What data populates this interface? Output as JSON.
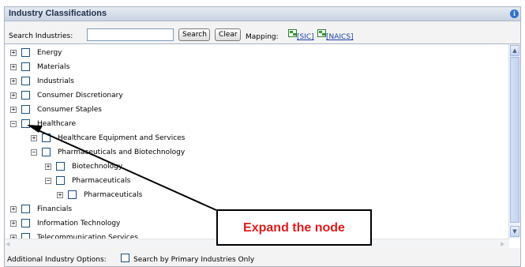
{
  "header": {
    "title": "Industry Classifications",
    "info_icon": "info-icon"
  },
  "search": {
    "label": "Search Industries:",
    "value": "",
    "placeholder": "",
    "search_button": "Search",
    "clear_button": "Clear",
    "mapping_label": "Mapping:",
    "sic_link": "[SIC]",
    "naics_link": "[NAICS]",
    "icons": [
      "excel-icon",
      "excel-icon"
    ]
  },
  "tree": {
    "nodes": [
      {
        "label": "Energy",
        "toggle": "+",
        "checked": false
      },
      {
        "label": "Materials",
        "toggle": "+",
        "checked": false
      },
      {
        "label": "Industrials",
        "toggle": "+",
        "checked": false
      },
      {
        "label": "Consumer Discretionary",
        "toggle": "+",
        "checked": false
      },
      {
        "label": "Consumer Staples",
        "toggle": "+",
        "checked": false
      },
      {
        "label": "Healthcare",
        "toggle": "−",
        "checked": false
      },
      {
        "label": "Healthcare Equipment and Services",
        "toggle": "+",
        "checked": false
      },
      {
        "label": "Pharmaceuticals and Biotechnology",
        "toggle": "−",
        "checked": false
      },
      {
        "label": "Biotechnology",
        "toggle": "+",
        "checked": false
      },
      {
        "label": "Pharmaceuticals",
        "toggle": "−",
        "checked": false
      },
      {
        "label": "Pharmaceuticals",
        "toggle": "+",
        "checked": false
      },
      {
        "label": "Financials",
        "toggle": "+",
        "checked": false
      },
      {
        "label": "Information Technology",
        "toggle": "+",
        "checked": false
      },
      {
        "label": "Telecommunication Services",
        "toggle": "+",
        "checked": false
      }
    ]
  },
  "footer": {
    "label": "Additional Industry Options:",
    "option": "Search by Primary Industries Only",
    "checked": false
  },
  "annotation": {
    "callout_text": "Expand the node",
    "text_color": "#e01b1b"
  }
}
